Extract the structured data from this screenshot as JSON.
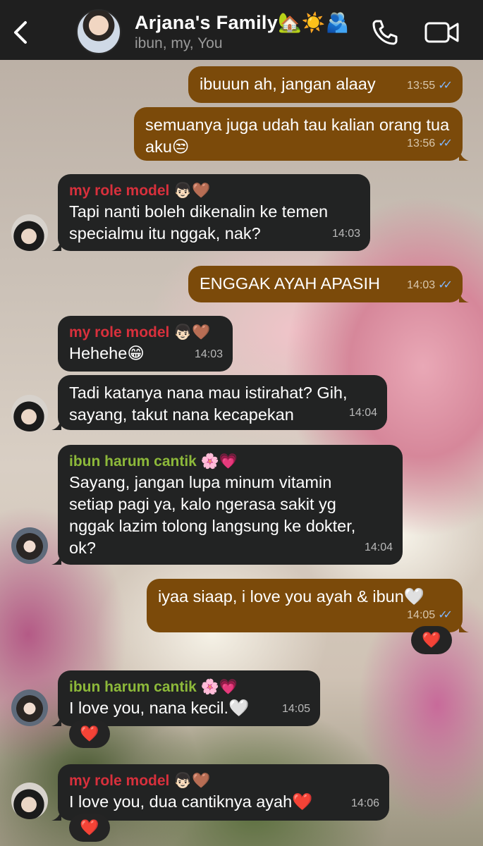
{
  "header": {
    "title": "Arjana's Family🏡☀️🫂",
    "members": "ibun, my, You"
  },
  "messages": [
    {
      "dir": "out",
      "text": "ibuuun ah, jangan alaay",
      "time": "13:55"
    },
    {
      "dir": "out",
      "text": "semuanya juga udah tau kalian orang tua aku😒",
      "time": "13:56"
    },
    {
      "dir": "in",
      "sender": "my role model 👦🏻🤎",
      "text": "Tapi nanti boleh dikenalin ke temen specialmu itu nggak, nak?",
      "time": "14:03"
    },
    {
      "dir": "out",
      "text": "ENGGAK AYAH APASIH",
      "time": "14:03"
    },
    {
      "dir": "in",
      "sender": "my role model 👦🏻🤎",
      "text": "Hehehe😁",
      "time": "14:03"
    },
    {
      "dir": "in",
      "text": "Tadi katanya nana mau istirahat? Gih, sayang, takut nana kecapekan",
      "time": "14:04"
    },
    {
      "dir": "in",
      "sender": "ibun harum cantik 🌸💗",
      "text": "Sayang, jangan lupa minum vitamin setiap pagi ya, kalo ngerasa sakit yg nggak lazim tolong langsung ke dokter, ok?",
      "time": "14:04"
    },
    {
      "dir": "out",
      "text": "iyaa siaap, i love you ayah & ibun🤍",
      "time": "14:05",
      "reaction": "❤️"
    },
    {
      "dir": "in",
      "sender": "ibun harum cantik 🌸💗",
      "text": "I love you, nana kecil.🤍",
      "time": "14:05",
      "reaction": "❤️"
    },
    {
      "dir": "in",
      "sender": "my role model 👦🏻🤎",
      "text": "I love you, dua cantiknya ayah❤️",
      "time": "14:06",
      "reaction": "❤️"
    }
  ],
  "colors": {
    "header_bg": "#1f1f1f",
    "outgoing_bubble": "#7b4a0a",
    "incoming_bubble": "#222323",
    "sender_dad": "#d8303c",
    "sender_mom": "#8db93a",
    "read_tick": "#7fb7ff"
  },
  "icons": [
    "back-icon",
    "phone-icon",
    "video-camera-icon",
    "double-check-icon",
    "heart-reaction-icon"
  ]
}
